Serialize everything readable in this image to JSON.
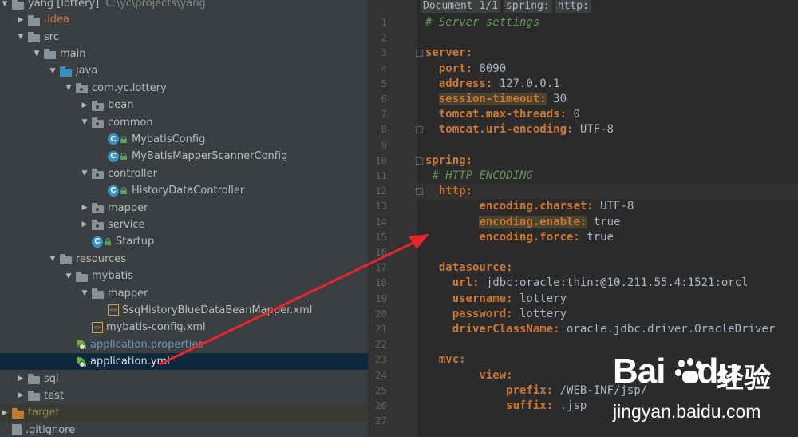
{
  "project_tree": {
    "root": {
      "name": "yang [lottery]",
      "path": "C:\\yc\\projects\\yang"
    },
    "items": [
      {
        "label": ".idea",
        "icon": "folder-icon",
        "depth": 1,
        "arrow": "collapsed",
        "style": "red"
      },
      {
        "label": "src",
        "icon": "folder-icon",
        "depth": 1,
        "arrow": "expanded"
      },
      {
        "label": "main",
        "icon": "folder-icon",
        "depth": 2,
        "arrow": "expanded"
      },
      {
        "label": "java",
        "icon": "source-folder-icon",
        "depth": 3,
        "arrow": "expanded"
      },
      {
        "label": "com.yc.lottery",
        "icon": "package-icon",
        "depth": 4,
        "arrow": "expanded"
      },
      {
        "label": "bean",
        "icon": "package-icon",
        "depth": 5,
        "arrow": "collapsed"
      },
      {
        "label": "common",
        "icon": "package-icon",
        "depth": 5,
        "arrow": "expanded"
      },
      {
        "label": "MybatisConfig",
        "icon": "class-icon",
        "depth": 6,
        "arrow": "none"
      },
      {
        "label": "MyBatisMapperScannerConfig",
        "icon": "class-icon",
        "depth": 6,
        "arrow": "none"
      },
      {
        "label": "controller",
        "icon": "package-icon",
        "depth": 5,
        "arrow": "expanded"
      },
      {
        "label": "HistoryDataController",
        "icon": "class-icon",
        "depth": 6,
        "arrow": "none"
      },
      {
        "label": "mapper",
        "icon": "package-icon",
        "depth": 5,
        "arrow": "collapsed"
      },
      {
        "label": "service",
        "icon": "package-icon",
        "depth": 5,
        "arrow": "collapsed"
      },
      {
        "label": "Startup",
        "icon": "spring-boot-class-icon",
        "depth": 5,
        "arrow": "none"
      },
      {
        "label": "resources",
        "icon": "resources-folder-icon",
        "depth": 3,
        "arrow": "expanded"
      },
      {
        "label": "mybatis",
        "icon": "folder-icon",
        "depth": 4,
        "arrow": "expanded"
      },
      {
        "label": "mapper",
        "icon": "folder-icon",
        "depth": 5,
        "arrow": "expanded"
      },
      {
        "label": "SsqHistoryBlueDataBeanMapper.xml",
        "icon": "xml-file-icon",
        "depth": 6,
        "arrow": "none"
      },
      {
        "label": "mybatis-config.xml",
        "icon": "xml-file-icon",
        "depth": 5,
        "arrow": "none"
      },
      {
        "label": "application.properties",
        "icon": "spring-config-icon",
        "depth": 4,
        "arrow": "none",
        "style": "blue"
      },
      {
        "label": "application.yml",
        "icon": "spring-config-icon",
        "depth": 4,
        "arrow": "none",
        "selected": true
      },
      {
        "label": "sql",
        "icon": "folder-icon",
        "depth": 1,
        "arrow": "collapsed"
      },
      {
        "label": "test",
        "icon": "folder-icon",
        "depth": 1,
        "arrow": "collapsed"
      },
      {
        "label": "target",
        "icon": "excluded-folder-icon",
        "depth": 0,
        "arrow": "collapsed",
        "style": "olive"
      },
      {
        "label": ".gitignore",
        "icon": "file-icon",
        "depth": 0,
        "arrow": "none"
      }
    ]
  },
  "editor": {
    "breadcrumbs": [
      "Document 1/1",
      "spring:",
      "http:"
    ],
    "lines": [
      {
        "n": "1",
        "html": "<span class='c'># Server settings</span>"
      },
      {
        "n": "2",
        "html": ""
      },
      {
        "n": "3",
        "html": "<span class='k'>server:</span>"
      },
      {
        "n": "4",
        "html": "  <span class='k'>port:</span> 8090"
      },
      {
        "n": "5",
        "html": "  <span class='k'>address:</span> 127.0.0.1"
      },
      {
        "n": "6",
        "html": "  <span class='hl'>session-timeout:</span> 30"
      },
      {
        "n": "7",
        "html": "  <span class='k'>tomcat.max-threads:</span> 0"
      },
      {
        "n": "8",
        "html": "  <span class='k'>tomcat.uri-encoding:</span> UTF-8"
      },
      {
        "n": "9",
        "html": ""
      },
      {
        "n": "10",
        "html": "<span class='k'>spring:</span>"
      },
      {
        "n": "11",
        "html": " <span class='c'># HTTP ENCODING</span>"
      },
      {
        "n": "12",
        "html": "  <span class='k'>http:</span>"
      },
      {
        "n": "13",
        "html": "        <span class='k'>encoding.charset:</span> UTF-8"
      },
      {
        "n": "14",
        "html": "        <span class='hl'>encoding.enable:</span> true"
      },
      {
        "n": "15",
        "html": "        <span class='k'>encoding.force:</span> true"
      },
      {
        "n": "16",
        "html": ""
      },
      {
        "n": "17",
        "html": "  <span class='k'>datasource:</span>"
      },
      {
        "n": "18",
        "html": "    <span class='k'>url:</span> jdbc:oracle:thin:@10.211.55.4:1521:orcl"
      },
      {
        "n": "19",
        "html": "    <span class='k'>username:</span> lottery"
      },
      {
        "n": "20",
        "html": "    <span class='k'>password:</span> lottery"
      },
      {
        "n": "21",
        "html": "    <span class='k'>driverClassName:</span> oracle.jdbc.driver.OracleDriver"
      },
      {
        "n": "22",
        "html": ""
      },
      {
        "n": "23",
        "html": "  <span class='k'>mvc:</span>"
      },
      {
        "n": "24",
        "html": "        <span class='k'>view:</span>"
      },
      {
        "n": "25",
        "html": "            <span class='k'>prefix:</span> /WEB-INF/jsp/"
      },
      {
        "n": "26",
        "html": "            <span class='k'>suffix:</span> .jsp"
      },
      {
        "n": "27",
        "html": ""
      }
    ]
  },
  "watermark": {
    "brand_left": "Bai",
    "brand_right": "du",
    "brand_cn": "经验",
    "url": "jingyan.baidu.com"
  },
  "colors": {
    "arrow": "#e8262a",
    "keyword": "#cc7832",
    "comment": "#629755",
    "selection": "#0d293e"
  }
}
